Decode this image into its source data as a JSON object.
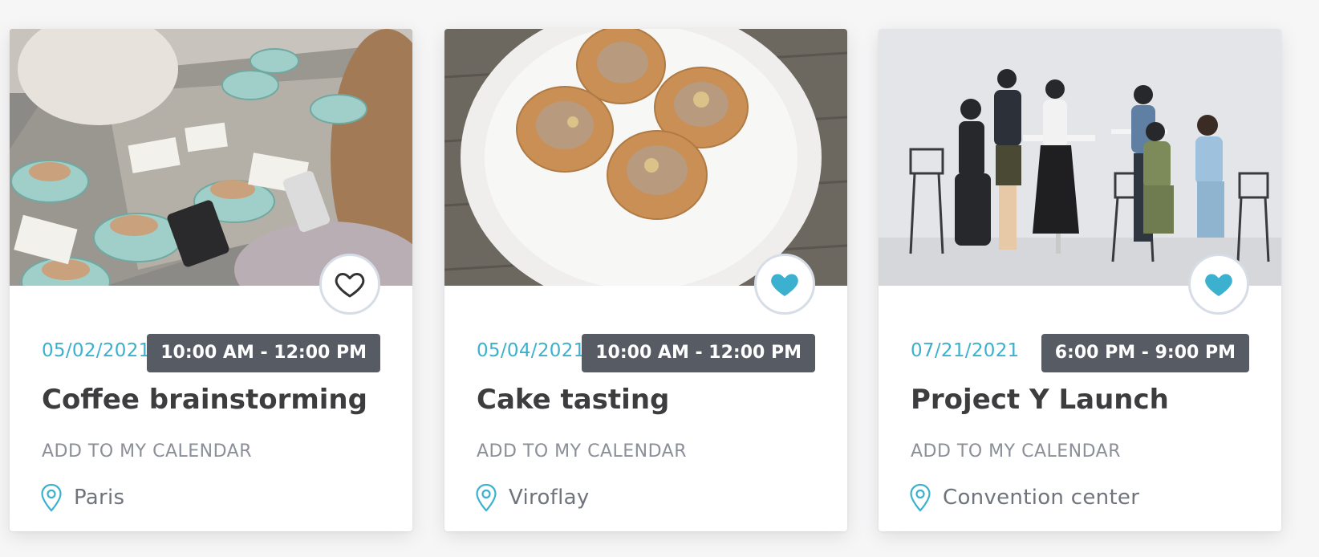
{
  "colors": {
    "accent": "#3bb1cf",
    "badge_bg": "#575b63",
    "title": "#3d3d3f",
    "muted": "#8b8f97"
  },
  "events": [
    {
      "image": "coffee-table-photo",
      "favorite": false,
      "favorite_icon": "heart-outline-icon",
      "date": "05/02/2021",
      "time": "10:00 AM - 12:00 PM",
      "title": "Coffee brainstorming",
      "calendar_label": "ADD TO MY CALENDAR",
      "location_icon": "map-pin-icon",
      "location": "Paris"
    },
    {
      "image": "cookies-plate-photo",
      "favorite": true,
      "favorite_icon": "heart-filled-icon",
      "date": "05/04/2021",
      "time": "10:00 AM - 12:00 PM",
      "title": "Cake tasting",
      "calendar_label": "ADD TO MY CALENDAR",
      "location_icon": "map-pin-icon",
      "location": "Viroflay"
    },
    {
      "image": "team-meeting-photo",
      "favorite": true,
      "favorite_icon": "heart-filled-icon",
      "date": "07/21/2021",
      "time": "6:00 PM - 9:00 PM",
      "title": "Project Y Launch",
      "calendar_label": "ADD TO MY CALENDAR",
      "location_icon": "map-pin-icon",
      "location": "Convention center"
    }
  ]
}
